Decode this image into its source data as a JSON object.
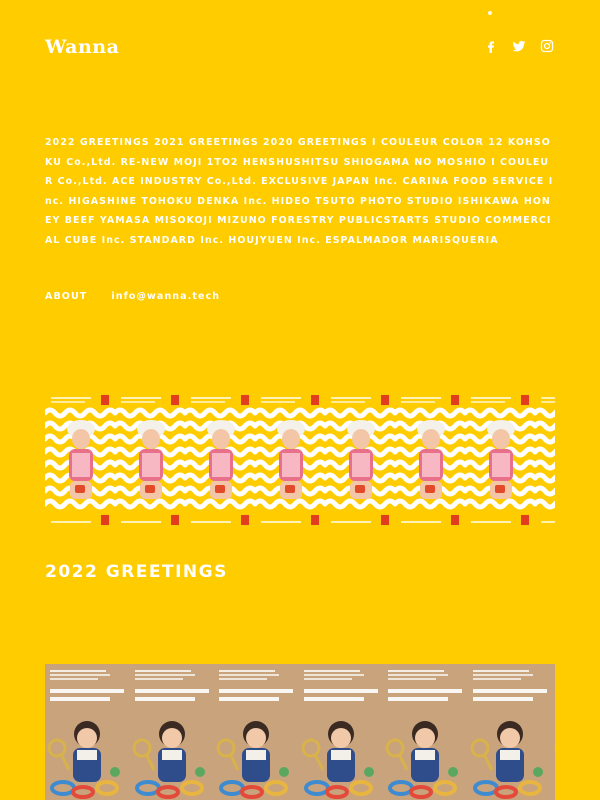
{
  "header": {
    "logo": "Wanna",
    "social": [
      "facebook-icon",
      "twitter-icon",
      "instagram-icon"
    ]
  },
  "clients_text": "2022 GREETINGS 2021 GREETINGS 2020 GREETINGS I COULEUR COLOR 12 KOHSOKU Co.,Ltd. RE-NEW MOJI 1TO2 HENSHUSHITSU SHIOGAMA NO MOSHIO I COULEUR Co.,Ltd. ACE INDUSTRY Co.,Ltd. EXCLUSIVE JAPAN Inc. CARINA FOOD SERVICE Inc. HIGASHINE TOHOKU DENKA Inc. HIDEO TSUTO PHOTO STUDIO ISHIKAWA HONEY BEEF YAMASA MISOKOJI MIZUNO FORESTRY PUBLICSTARTS STUDIO COMMERCIAL CUBE Inc. STANDARD Inc. HOUJYUEN Inc. ESPALMADOR MARISQUERIA",
  "links": {
    "about": "ABOUT",
    "email": "info@wanna.tech"
  },
  "section": {
    "title": "2022 GREETINGS"
  },
  "colors": {
    "background": "#ffcc00",
    "text": "#ffffff",
    "stamp": "#e23d1f",
    "card_bg": "#c9a37c"
  }
}
